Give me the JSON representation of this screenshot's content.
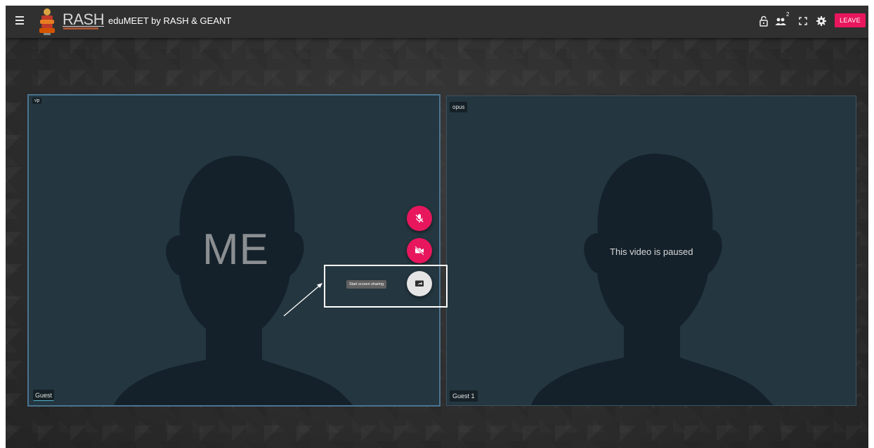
{
  "topbar": {
    "brand": "RASH",
    "room_title": "eduMEET by RASH & GEANT",
    "participant_count": "2",
    "leave_label": "LEAVE",
    "icons": [
      "menu-icon",
      "lock-icon",
      "participants-icon",
      "fullscreen-icon",
      "settings-icon"
    ]
  },
  "tiles": {
    "me": {
      "center_label": "ME",
      "codec": "vp",
      "name": "Guest"
    },
    "peer": {
      "codec": "opus",
      "status": "This video is paused",
      "name": "Guest 1"
    }
  },
  "controls": {
    "mic_icon": "mic-off-icon",
    "camera_icon": "videocam-off-icon",
    "share_icon": "screen-share-icon",
    "share_tooltip": "Start screen sharing"
  },
  "colors": {
    "accent": "#e8175d",
    "topbar": "#303030",
    "tile": "#24363f",
    "active_border": "#4b7390"
  }
}
